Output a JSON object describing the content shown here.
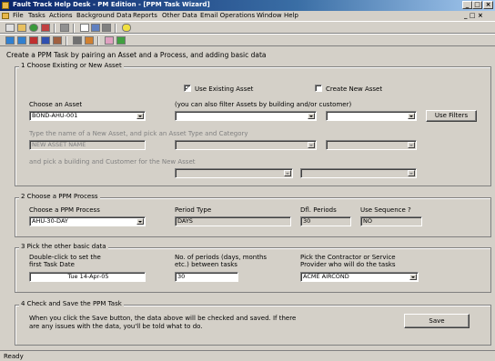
{
  "window": {
    "title": "Fault Track Help Desk - PM Edition - [PPM Task Wizard]",
    "controls": [
      "_",
      "□",
      "×"
    ]
  },
  "menu": [
    "File",
    "Tasks",
    "Actions",
    "Background Data",
    "Reports",
    "Other Data",
    "Email Operations",
    "Window",
    "Help"
  ],
  "toolbar_icons": [
    "new-task-icon",
    "open-folder-icon",
    "green-globe-icon",
    "calendar-icon",
    "print-icon",
    "table-icon",
    "grid-icon",
    "chart-icon",
    "lightbulb-icon",
    "arrow-right-icon",
    "arrow-left-icon",
    "flag-red-icon",
    "flag-blue-icon",
    "people-icon",
    "printer-icon",
    "paintbrush-icon",
    "eraser-icon",
    "check-icon"
  ],
  "intro": "Create a PPM Task by pairing an Asset and a Process, and adding basic data",
  "section1": {
    "title": "1  Choose Existing or New Asset",
    "use_existing": "Use Existing Asset",
    "use_existing_checked": true,
    "create_new": "Create New Asset",
    "create_new_checked": false,
    "choose_asset_label": "Choose an Asset",
    "asset_value": "BOND-AHU-001",
    "filter_label": "(you can also filter Assets by building and/or customer)",
    "filter_button": "Use Filters",
    "type_new_label": "Type the name of a New Asset, and pick an Asset Type and Category",
    "new_asset_placeholder": "NEW ASSET NAME",
    "building_label": "and pick a building and Customer for the New Asset"
  },
  "section2": {
    "title": "2  Choose a PPM Process",
    "choose_process_label": "Choose a PPM Process",
    "process_value": "AHU-30-DAY",
    "period_type_label": "Period Type",
    "period_type_value": "DAYS",
    "dfl_periods_label": "Dfl. Periods",
    "dfl_periods_value": "30",
    "use_sequence_label": "Use Sequence ?",
    "use_sequence_value": "NO"
  },
  "section3": {
    "title": "3  Pick the other basic data",
    "first_date_label_1": "Double-click to set the",
    "first_date_label_2": "first Task Date",
    "first_date_value": "Tue 14-Apr-05",
    "periods_label_1": "No. of periods (days, months",
    "periods_label_2": "etc.) between tasks",
    "periods_value": "30",
    "contractor_label_1": "Pick the Contractor or Service",
    "contractor_label_2": "Provider who will do the tasks",
    "contractor_value": "ACME AIRCOND"
  },
  "section4": {
    "title": "4  Check and Save the PPM Task",
    "text_1": "When you click the Save button, the data above will be checked and saved. If there",
    "text_2": "are any issues with the data, you'll be told what to do.",
    "save_button": "Save"
  },
  "status": "Ready"
}
